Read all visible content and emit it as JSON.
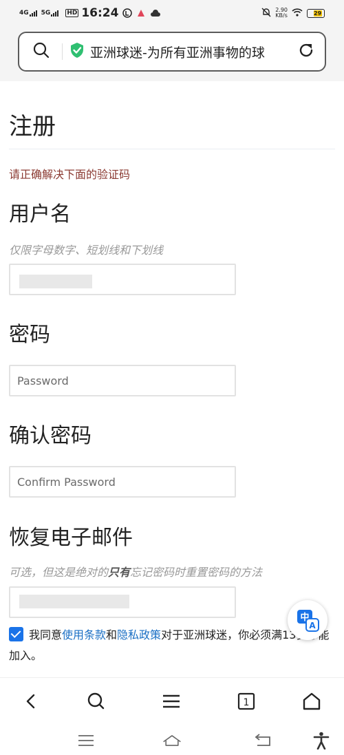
{
  "status_bar": {
    "signal1": "4G",
    "signal2": "5G",
    "hd": "HD",
    "time": "16:24",
    "net_speed": "2.90",
    "net_unit": "KB/s",
    "battery": "29"
  },
  "url_bar": {
    "title": "亚洲球迷-为所有亚洲事物的球"
  },
  "form": {
    "heading": "注册",
    "captcha_error": "请正确解决下面的验证码",
    "username_label": "用户名",
    "username_hint": "仅限字母数字、短划线和下划线",
    "username_value": "",
    "password_label": "密码",
    "password_placeholder": "Password",
    "confirm_label": "确认密码",
    "confirm_placeholder": "Confirm Password",
    "email_label": "恢复电子邮件",
    "email_hint_before": "可选，但这是绝对的",
    "email_hint_bold": "只有",
    "email_hint_after": "忘记密码时重置密码的方法",
    "email_value": "",
    "agree_prefix": "我同意",
    "terms_link": "使用条款",
    "agree_and": "和",
    "privacy_link": "隐私政策",
    "agree_suffix": "对于亚洲球迷，你必须满13岁才能加入。"
  },
  "colors": {
    "accent": "#1a73e8",
    "error": "#8b3a32",
    "link": "#1a6fc4",
    "shield": "#2fbf71"
  }
}
